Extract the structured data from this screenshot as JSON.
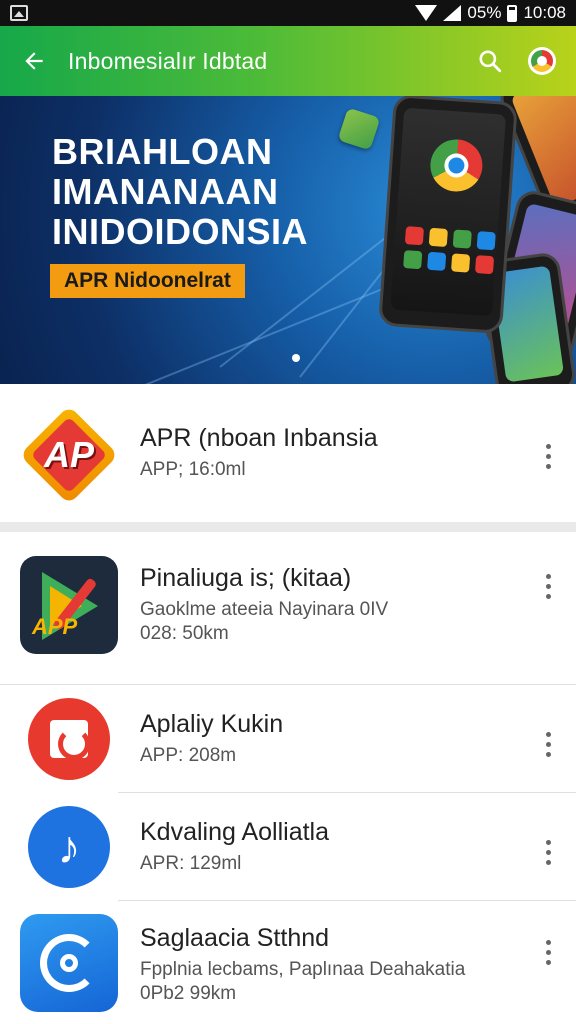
{
  "status_bar": {
    "battery": "05%",
    "time": "10:08"
  },
  "app_bar": {
    "title": "Inbomesialır Idbtad"
  },
  "banner": {
    "headline_lines": [
      "BRIAHLOAN",
      "IMANANAAN",
      "INIDOIDONSIA"
    ],
    "tag": "APR Nidoonelrat"
  },
  "apps": [
    {
      "title": "APR (nboan Inbansia",
      "sub": "APP; 16:0ml"
    },
    {
      "title": "Pinaliuga is; (kitaa)",
      "sub": "Gaoklme ateeia Nayinara 0IV",
      "sub2": "028: 50km"
    },
    {
      "title": "Aplaliy Kukin",
      "sub": "APP: 208m"
    },
    {
      "title": "Kdvaling Aolliatla",
      "sub": "APR: 129ml"
    },
    {
      "title": "Saglaacia Stthnd",
      "sub": "Fpplnia lecbams, Paplınaa Deahakatia",
      "sub2": "0Pb2 99km"
    }
  ],
  "icons": {
    "apr_label": "AP",
    "play_label": "APP",
    "blue_glyph": "♪"
  },
  "colors": {
    "appbar_start": "#16a84a",
    "appbar_end": "#b9d21a",
    "banner_dark": "#0d2f66",
    "tag_orange": "#f39c12"
  }
}
